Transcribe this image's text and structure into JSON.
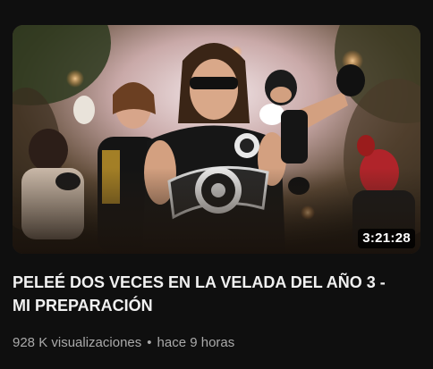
{
  "video": {
    "duration": "3:21:28",
    "title": "PELEÉ DOS VECES EN LA VELADA DEL AÑO 3 - MI PREPARACIÓN",
    "views": "928 K visualizaciones",
    "separator": "•",
    "age": "hace 9 horas"
  },
  "colors": {
    "background": "#0f0f0f",
    "title": "#f1f1f1",
    "meta": "#aaaaaa"
  }
}
